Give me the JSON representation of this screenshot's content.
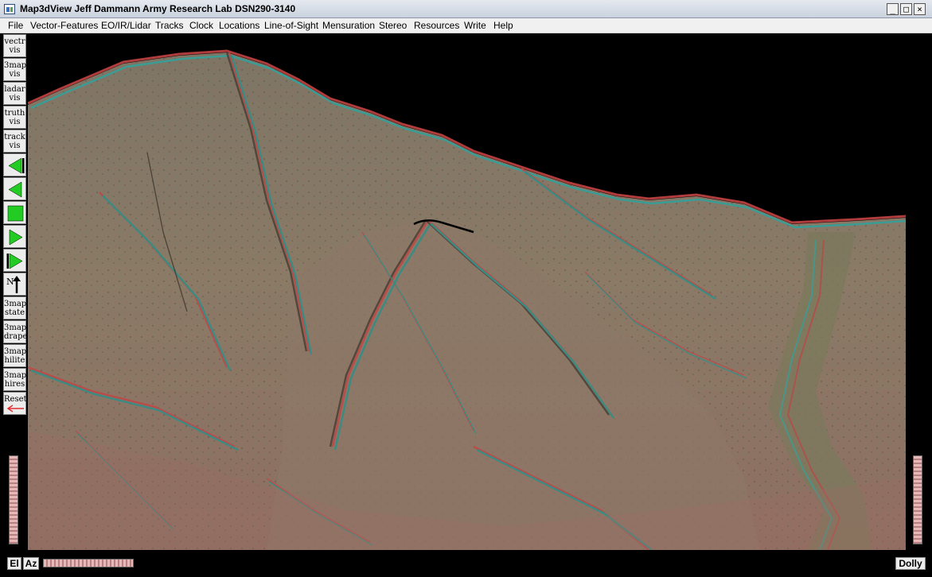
{
  "window": {
    "title": "Map3dView Jeff Dammann Army Research Lab DSN290-3140",
    "minimize_glyph": "_",
    "maximize_glyph": "□",
    "close_glyph": "×"
  },
  "menu": [
    "File",
    "Vector-Features",
    "EO/IR/Lidar",
    "Tracks",
    "Clock",
    "Locations",
    "Line-of-Sight",
    "Mensuration",
    "Stereo",
    "Resources",
    "Write",
    "Help"
  ],
  "toolbar": {
    "vectr_vis": [
      "vectr",
      "vis"
    ],
    "map_vis": [
      "3map",
      "vis"
    ],
    "ladar_vis": [
      "ladar",
      "vis"
    ],
    "truth_vis": [
      "truth",
      "vis"
    ],
    "track_vis": [
      "track",
      "vis"
    ],
    "north_label": "N",
    "map_state": [
      "3map",
      "state"
    ],
    "map_drape": [
      "3map",
      "drape"
    ],
    "map_hilite": [
      "3map",
      "hilite"
    ],
    "map_hires": [
      "3map",
      "hires"
    ],
    "reset": "Reset",
    "play_color": "#22cc22",
    "reset_arrow_color": "#e03030"
  },
  "bottom": {
    "el_label": "El",
    "az_label": "Az",
    "dolly_label": "Dolly"
  },
  "icons": {
    "app": "map3dview-app-icon",
    "step_back_to_start": "rewind-to-start-icon",
    "step_back": "play-reverse-icon",
    "stop": "stop-icon",
    "play": "play-icon",
    "step_to_end": "forward-to-end-icon",
    "north": "north-arrow-icon",
    "reset": "left-arrow-icon"
  }
}
